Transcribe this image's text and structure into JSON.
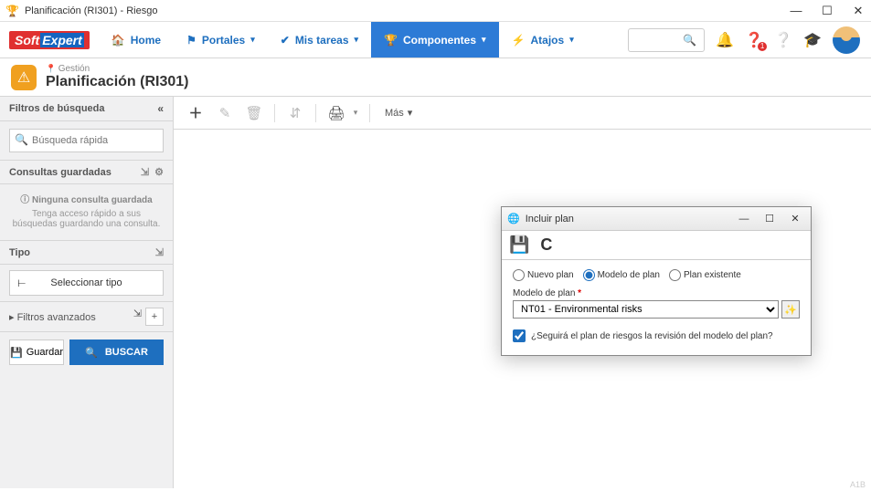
{
  "window": {
    "title": "Planificación (RI301) - Riesgo"
  },
  "nav": {
    "home": "Home",
    "portales": "Portales",
    "tareas": "Mis tareas",
    "componentes": "Componentes",
    "atajos": "Atajos"
  },
  "header": {
    "crumb": "Gestión",
    "title": "Planificación (RI301)"
  },
  "sidebar": {
    "filters_title": "Filtros de búsqueda",
    "quick_placeholder": "Búsqueda rápida",
    "saved_title": "Consultas guardadas",
    "saved_empty_heading": "Ninguna consulta guardada",
    "saved_empty_text": "Tenga acceso rápido a sus búsquedas guardando una consulta.",
    "type_title": "Tipo",
    "type_button": "Seleccionar tipo",
    "advanced": "Filtros avanzados",
    "save_btn": "Guardar",
    "search_btn": "BUSCAR"
  },
  "toolbar": {
    "more": "Más"
  },
  "modal": {
    "title": "Incluir plan",
    "radio_nuevo": "Nuevo plan",
    "radio_modelo": "Modelo de plan",
    "radio_existente": "Plan existente",
    "field_label": "Modelo de plan",
    "field_value": "NT01 - Environmental risks",
    "checkbox_label": "¿Seguirá el plan de riesgos la revisión del modelo del plan?"
  },
  "footer": "A1B"
}
